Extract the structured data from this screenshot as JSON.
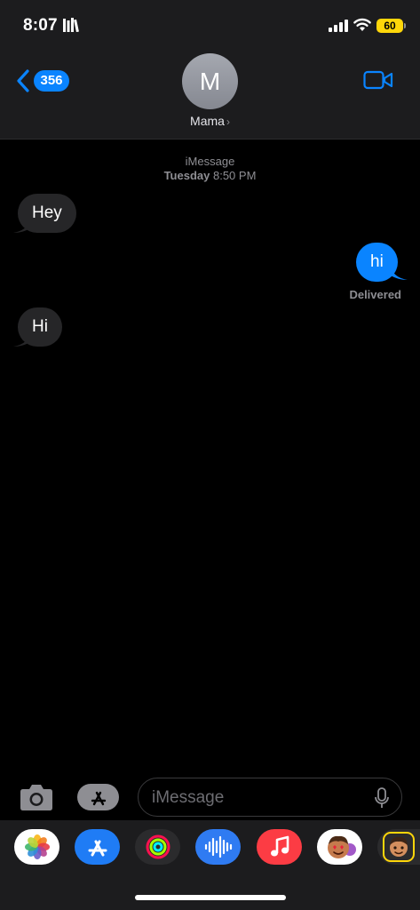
{
  "status_bar": {
    "time": "8:07",
    "battery": "60"
  },
  "header": {
    "back_count": "356",
    "avatar_initial": "M",
    "contact_name": "Mama",
    "chevron": "›"
  },
  "conversation": {
    "service": "iMessage",
    "day": "Tuesday",
    "time": "8:50 PM",
    "messages": [
      {
        "direction": "incoming",
        "text": "Hey"
      },
      {
        "direction": "outgoing",
        "text": "hi"
      },
      {
        "direction": "incoming",
        "text": "Hi"
      }
    ],
    "delivered": "Delivered"
  },
  "composer": {
    "placeholder": "iMessage"
  },
  "app_drawer": {
    "apps": [
      "photos-icon",
      "app-store-icon",
      "activity-icon",
      "audio-message-icon",
      "music-icon",
      "memoji-stickers-icon",
      "memoji-icon"
    ]
  },
  "colors": {
    "accent": "#0a84ff",
    "incoming_bubble": "#262628",
    "battery": "#ffd60a",
    "background": "#000000"
  }
}
